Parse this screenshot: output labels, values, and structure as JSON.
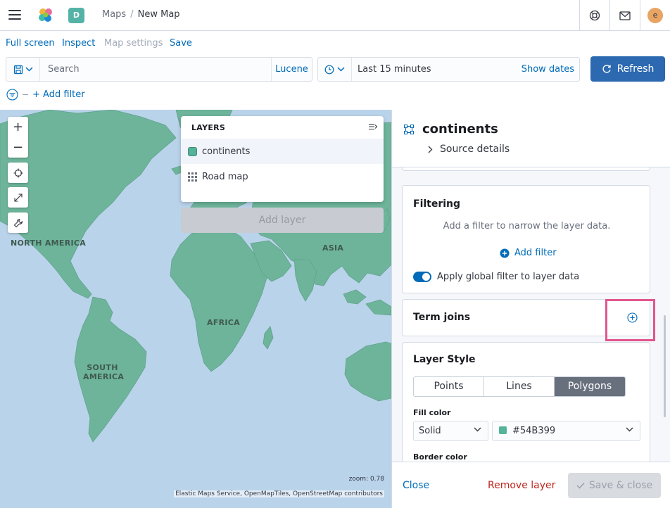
{
  "header": {
    "space_initial": "D",
    "breadcrumbs": [
      "Maps",
      "New Map"
    ],
    "user_initial": "e"
  },
  "topnav": {
    "items": [
      "Full screen",
      "Inspect",
      "Map settings",
      "Save"
    ]
  },
  "querybar": {
    "search_placeholder": "Search",
    "language": "Lucene"
  },
  "datepicker": {
    "value": "Last 15 minutes",
    "show_dates": "Show dates"
  },
  "refresh_label": "Refresh",
  "filterbar": {
    "add_filter": "+ Add filter"
  },
  "map": {
    "labels": [
      "NORTH AMERICA",
      "SOUTH AMERICA",
      "AFRICA",
      "ASIA"
    ],
    "zoom": "zoom: 0.78",
    "attribution": "Elastic Maps Service, OpenMapTiles, OpenStreetMap contributors",
    "land_color": "#6eb49b",
    "water_color": "#b9d3ea"
  },
  "layers": {
    "title": "LAYERS",
    "items": [
      {
        "name": "continents",
        "icon": "color-swatch-icon",
        "selected": true
      },
      {
        "name": "Road map",
        "icon": "tile-grid-icon",
        "selected": false
      }
    ],
    "add_layer": "Add layer"
  },
  "flyout": {
    "title": "continents",
    "source_details": "Source details",
    "filtering": {
      "title": "Filtering",
      "hint": "Add a filter to narrow the layer data.",
      "add_filter": "Add filter",
      "apply_global": "Apply global filter to layer data",
      "apply_global_on": true
    },
    "term_joins": {
      "title": "Term joins"
    },
    "layer_style": {
      "title": "Layer Style",
      "tabs": [
        "Points",
        "Lines",
        "Polygons"
      ],
      "active_tab": "Polygons",
      "fill_color_label": "Fill color",
      "fill_mode": "Solid",
      "fill_color": "#54B399",
      "border_color_label": "Border color"
    },
    "footer": {
      "close": "Close",
      "remove": "Remove layer",
      "save": "Save & close"
    }
  },
  "colors": {
    "primary": "#006bb8",
    "refresh_bg": "#2c69b0",
    "danger": "#bd271e",
    "highlight": "#e2568d"
  }
}
